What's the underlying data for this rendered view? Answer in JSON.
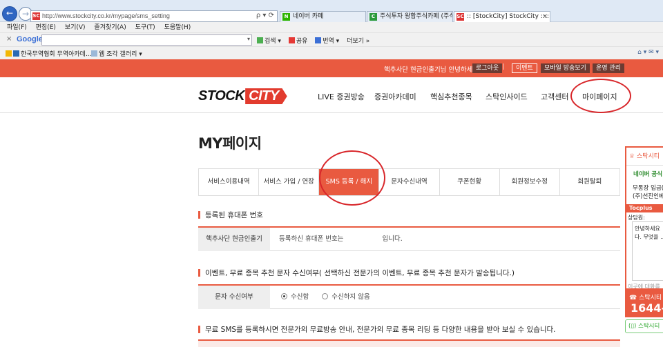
{
  "browser": {
    "url": "http://www.stockcity.co.kr/mypage/sms_setting",
    "favicon": "SC",
    "addr_icons": "ρ ▾ ⟳",
    "tabs": [
      {
        "label": "네이버 카페",
        "favicon": "N"
      },
      {
        "label": "주식투자 왕합주식카페 (주식/...",
        "favicon": "C"
      },
      {
        "label": ":: [StockCity] StockCity ::::",
        "favicon": "SC"
      }
    ],
    "menu": [
      "파일(F)",
      "편집(E)",
      "보기(V)",
      "즐겨찾기(A)",
      "도구(T)",
      "도움말(H)"
    ],
    "google": {
      "close": "×",
      "logo": "Google",
      "tools": [
        "검색 ▾",
        "공유",
        "번역 ▾",
        "더보기 »"
      ]
    },
    "favorites": [
      {
        "label": "한국무역협회 무역아카데..."
      },
      {
        "label": "웹 조각 갤러리 ▾"
      }
    ],
    "right_tools": "⌂ ▾ ✉ ▾"
  },
  "topbar": {
    "greeting": "핵추사단 현금인출기님 안녕하세요",
    "logout": "로그아웃",
    "separator": "|",
    "event": "이벤트",
    "mobile": "모바일 방송보기",
    "admin": "운영 관리"
  },
  "header": {
    "logo_stock": "STOCK",
    "logo_city": "CITY",
    "nav": [
      "LIVE 증권방송",
      "증권아카데미",
      "핵심추천종목",
      "스탁인사이드",
      "고객센터",
      "마이페이지"
    ]
  },
  "page": {
    "title": "MY페이지",
    "tabs": [
      "서비스이용내역",
      "서비스 가입 / 연장",
      "SMS 등록 / 해지",
      "문자수신내역",
      "쿠폰현황",
      "회원정보수정",
      "회원탈퇴"
    ],
    "active_tab": 2
  },
  "section1": {
    "title": "등록된 휴대폰 번호",
    "label": "핵추사단 현금인출기",
    "value_prefix": "등록하신 휴대폰 번호는",
    "value_suffix": "입니다."
  },
  "section2": {
    "title": "이벤트, 무료 종목 추천 문자 수신여부( 선택하신 전문가의 이벤트, 무료 종목 추천 문자가 발송됩니다.)",
    "label": "문자 수신여부",
    "options": [
      "수신함",
      "수신하지 않음"
    ],
    "selected": 0
  },
  "section3": {
    "title": "무료 SMS를 등록하시면 전문가의 무료방송 안내, 전문가의 무료 종목 리딩 등 다양한 내용을 받아 보실 수 있습니다."
  },
  "widget": {
    "head": "♕ 스탁시티",
    "naver": "네이버 공식",
    "lines": [
      "무통장 입금(",
      "(주)선진인베스"
    ],
    "bar": "Tocplus",
    "chat_label": "상담원:",
    "chat_lines": [
      "안녕하세요",
      "다. 무엇을 ..."
    ],
    "input_placeholder": "이곳에 대화를",
    "phone_label": "☎ 스탁시티",
    "phone": "1644-",
    "footer": "(▯) 스탁시티"
  },
  "colors": {
    "accent": "#e95a40",
    "annotation_circle": "#d8262a"
  }
}
